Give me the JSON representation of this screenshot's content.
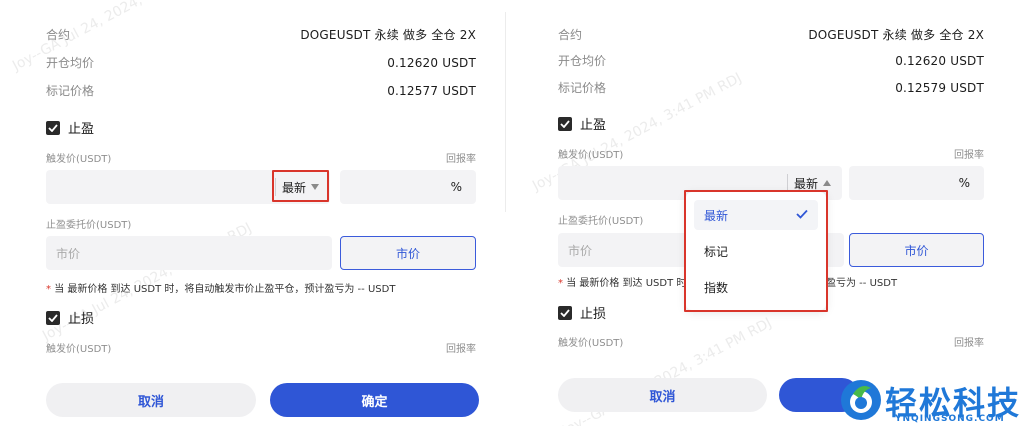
{
  "left_panel": {
    "contract_label": "合约",
    "contract_value": "DOGEUSDT 永续 做多 全仓 2X",
    "entry_label": "开仓均价",
    "entry_value": "0.12620 USDT",
    "mark_label": "标记价格",
    "mark_value": "0.12577 USDT",
    "tp_label": "止盈",
    "trigger_label": "触发价(USDT)",
    "return_label": "回报率",
    "trigger_type": "最新",
    "percent": "%",
    "order_price_label": "止盈委托价(USDT)",
    "order_placeholder": "市价",
    "market_button": "市价",
    "note_prefix": "* ",
    "note_text": "当 最新价格 到达 USDT 时，将自动触发市价止盈平仓，预计盈亏为 -- USDT",
    "sl_label": "止损",
    "sl_trigger_label": "触发价(USDT)",
    "sl_return_label": "回报率",
    "cancel": "取消",
    "confirm": "确定"
  },
  "right_panel": {
    "contract_label": "合约",
    "contract_value": "DOGEUSDT 永续 做多 全仓 2X",
    "entry_label": "开仓均价",
    "entry_value": "0.12620 USDT",
    "mark_label": "标记价格",
    "mark_value": "0.12579 USDT",
    "tp_label": "止盈",
    "trigger_label": "触发价(USDT)",
    "return_label": "回报率",
    "trigger_type": "最新",
    "percent": "%",
    "order_price_label": "止盈委托价(USDT)",
    "order_placeholder": "市价",
    "market_button": "市价",
    "note_prefix": "* ",
    "note_text": "当 最新价格 到达 USDT 时",
    "note_tail": "盈亏为 -- USDT",
    "sl_label": "止损",
    "sl_trigger_label": "触发价(USDT)",
    "sl_return_label": "回报率",
    "cancel": "取消",
    "dropdown": {
      "items": [
        "最新",
        "标记",
        "指数"
      ],
      "selected": "最新"
    }
  },
  "watermarks": [
    "Joy--GA Jul 24, 2024, 3:41 PM RDJ",
    "Joy--GA Jul 24, 2024, 3:41 PM RDJ",
    "Joy--GA Jul 24, 2024, 3:41 PM RDJ",
    "Joy--GA Jul 24, 2024, 3:41 PM RDJ"
  ],
  "logo": {
    "zh": "轻松科技",
    "en": "YNQINGSONG.COM"
  },
  "colors": {
    "accent": "#2f56d6",
    "highlight": "#d9352b",
    "logo": "#1f78d8"
  }
}
